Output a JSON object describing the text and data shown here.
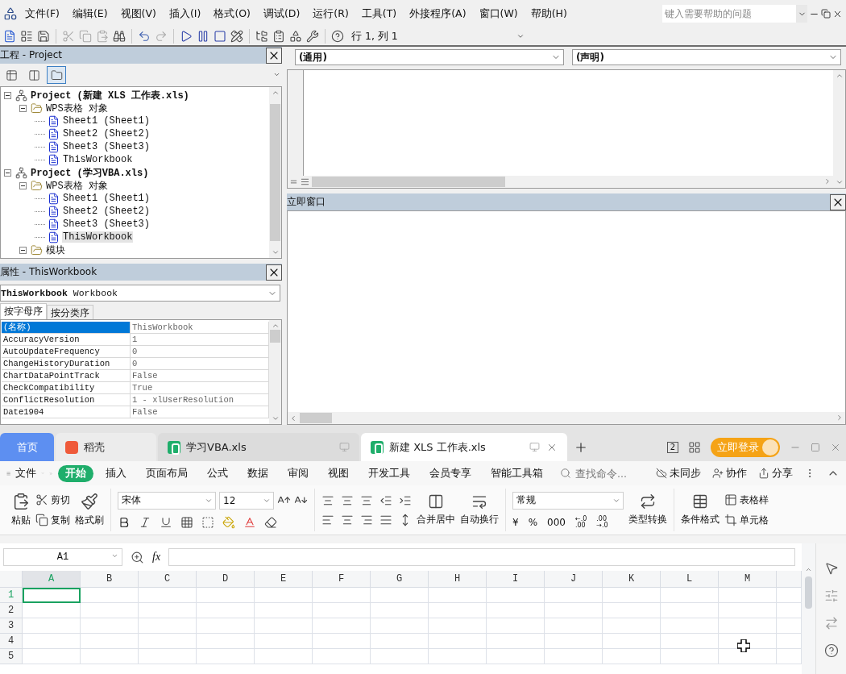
{
  "vbe": {
    "menu": [
      "文件(F)",
      "编辑(E)",
      "视图(V)",
      "插入(I)",
      "格式(O)",
      "调试(D)",
      "运行(R)",
      "工具(T)",
      "外接程序(A)",
      "窗口(W)",
      "帮助(H)"
    ],
    "help_box": {
      "placeholder": "键入需要帮助的问题"
    },
    "position": "行 1, 列 1",
    "project_pane": {
      "title": "工程 - Project",
      "view_buttons": [
        {
          "selected": false
        },
        {
          "selected": false
        },
        {
          "selected": true
        }
      ],
      "tree": [
        {
          "label": "Project (新建 XLS 工作表.xls)",
          "kind": "project",
          "expanded": true,
          "selected": false,
          "children": [
            {
              "label": "WPS表格 对象",
              "kind": "folder",
              "expanded": true,
              "selected": false,
              "children": [
                {
                  "label": "Sheet1 (Sheet1)",
                  "kind": "document",
                  "selected": false
                },
                {
                  "label": "Sheet2 (Sheet2)",
                  "kind": "document",
                  "selected": false
                },
                {
                  "label": "Sheet3 (Sheet3)",
                  "kind": "document",
                  "selected": false
                },
                {
                  "label": "ThisWorkbook",
                  "kind": "document",
                  "selected": false
                }
              ]
            }
          ]
        },
        {
          "label": "Project (学习VBA.xls)",
          "kind": "project",
          "expanded": true,
          "selected": false,
          "children": [
            {
              "label": "WPS表格 对象",
              "kind": "folder",
              "expanded": true,
              "selected": false,
              "children": [
                {
                  "label": "Sheet1 (Sheet1)",
                  "kind": "document",
                  "selected": false
                },
                {
                  "label": "Sheet2 (Sheet2)",
                  "kind": "document",
                  "selected": false
                },
                {
                  "label": "Sheet3 (Sheet3)",
                  "kind": "document",
                  "selected": false
                },
                {
                  "label": "ThisWorkbook",
                  "kind": "document",
                  "selected": true
                }
              ]
            },
            {
              "label": "模块",
              "kind": "folder",
              "expanded": true,
              "selected": false
            }
          ]
        }
      ]
    },
    "properties_pane": {
      "title": "属性 - ThisWorkbook",
      "object": "**ThisWorkbook** Workbook",
      "tabs": [
        {
          "label": "按字母序",
          "selected": true
        },
        {
          "label": "按分类序",
          "selected": false
        }
      ],
      "rows": [
        {
          "name": "(名称)",
          "value": "ThisWorkbook",
          "selected": true
        },
        {
          "name": "AccuracyVersion",
          "value": "1",
          "selected": false
        },
        {
          "name": "AutoUpdateFrequency",
          "value": "0",
          "selected": false
        },
        {
          "name": "ChangeHistoryDuration",
          "value": "0",
          "selected": false
        },
        {
          "name": "ChartDataPointTrack",
          "value": "False",
          "selected": false
        },
        {
          "name": "CheckCompatibility",
          "value": "True",
          "selected": false
        },
        {
          "name": "ConflictResolution",
          "value": "1 - xlUserResolution",
          "selected": false
        },
        {
          "name": "Date1904",
          "value": "False",
          "selected": false
        }
      ]
    },
    "code_window": {
      "object": "(通用)",
      "procedure": "(声明)"
    },
    "immediate_window": {
      "title": "立即窗口"
    }
  },
  "wps": {
    "tabs": [
      {
        "label": "首页",
        "kind": "home",
        "selected": false
      },
      {
        "label": "稻壳",
        "kind": "docer",
        "selected": false
      },
      {
        "label": "学习VBA.xls",
        "kind": "sheet",
        "selected": false
      },
      {
        "label": "新建 XLS 工作表.xls",
        "kind": "sheet",
        "selected": true
      }
    ],
    "window_count": "2",
    "login": "立即登录",
    "file_menu": "文件",
    "ribbon_tabs": [
      {
        "label": "开始",
        "selected": true
      },
      {
        "label": "插入",
        "selected": false
      },
      {
        "label": "页面布局",
        "selected": false
      },
      {
        "label": "公式",
        "selected": false
      },
      {
        "label": "数据",
        "selected": false
      },
      {
        "label": "审阅",
        "selected": false
      },
      {
        "label": "视图",
        "selected": false
      },
      {
        "label": "开发工具",
        "selected": false
      },
      {
        "label": "会员专享",
        "selected": false
      },
      {
        "label": "智能工具箱",
        "selected": false
      }
    ],
    "command_search": {
      "placeholder": "查找命令..."
    },
    "actions": [
      {
        "label": "未同步",
        "kind": "sync"
      },
      {
        "label": "协作",
        "kind": "collab"
      },
      {
        "label": "分享",
        "kind": "share"
      }
    ],
    "ribbon": {
      "paste": "粘贴",
      "cut": "剪切",
      "copy": "复制",
      "format_painter": "格式刷",
      "font_name": "宋体",
      "font_size": "12",
      "merge": "合并居中",
      "wrap": "自动换行",
      "number_format": "常规",
      "number_symbols": [
        "¥",
        "%",
        "000"
      ],
      "decimals": [
        {
          "top": "←.0",
          "bottom": ".00"
        },
        {
          "top": ".00",
          "bottom": "→.0"
        }
      ],
      "convert": "类型转换",
      "conditional": "条件格式",
      "table_style": "表格样",
      "cell_style": "单元格"
    },
    "formula_bar": {
      "cell": "A1",
      "fx": "fx"
    },
    "sheet": {
      "columns": [
        {
          "label": "A",
          "selected": true
        },
        {
          "label": "B",
          "selected": false
        },
        {
          "label": "C",
          "selected": false
        },
        {
          "label": "D",
          "selected": false
        },
        {
          "label": "E",
          "selected": false
        },
        {
          "label": "F",
          "selected": false
        },
        {
          "label": "G",
          "selected": false
        },
        {
          "label": "H",
          "selected": false
        },
        {
          "label": "I",
          "selected": false
        },
        {
          "label": "J",
          "selected": false
        },
        {
          "label": "K",
          "selected": false
        },
        {
          "label": "L",
          "selected": false
        },
        {
          "label": "M",
          "selected": false
        }
      ],
      "rows": [
        {
          "label": "1",
          "selected": true
        },
        {
          "label": "2",
          "selected": false
        },
        {
          "label": "3",
          "selected": false
        },
        {
          "label": "4",
          "selected": false
        },
        {
          "label": "5",
          "selected": false
        }
      ]
    }
  }
}
